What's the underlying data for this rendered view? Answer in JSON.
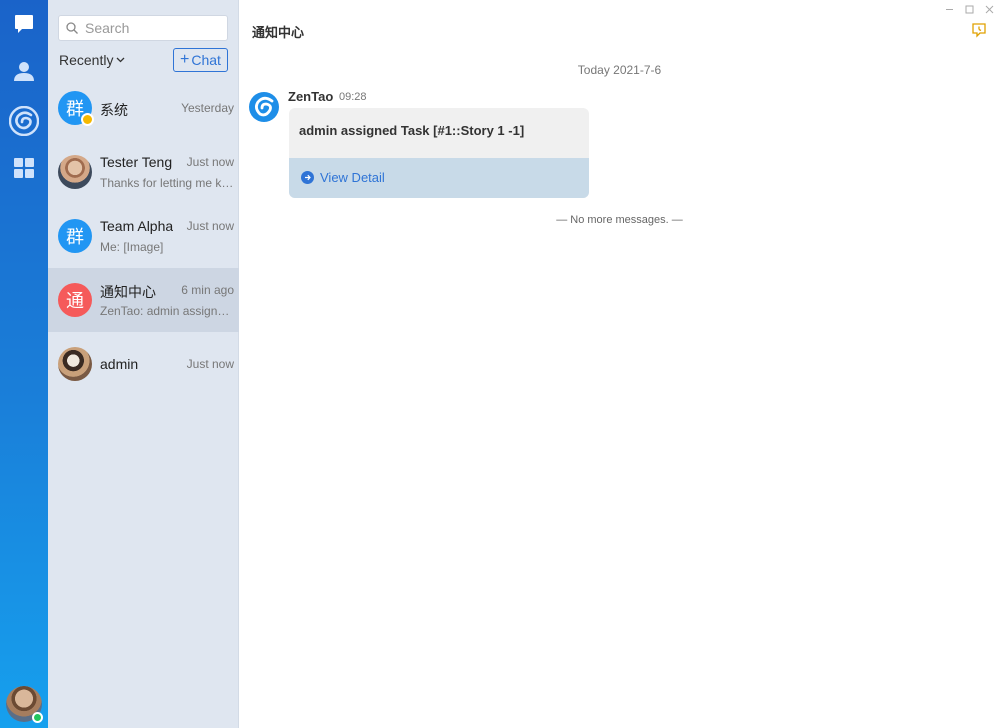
{
  "colors": {
    "rail_top": "#1a63c9",
    "rail_bottom": "#16a0ee",
    "accent": "#2f74d6",
    "online": "#22c55e"
  },
  "rail": {
    "items": [
      "chat-bubble-icon",
      "contacts-icon",
      "zentao-icon",
      "apps-grid-icon"
    ]
  },
  "search": {
    "placeholder": "Search"
  },
  "list_header": {
    "recently": "Recently",
    "chat_button": "Chat"
  },
  "conversations": [
    {
      "avatar_text": "群",
      "name": "系统",
      "time": "Yesterday",
      "preview": ""
    },
    {
      "avatar_text": "",
      "name": "Tester Teng",
      "time": "Just now",
      "preview": "Thanks for letting me know."
    },
    {
      "avatar_text": "群",
      "name": "Team Alpha",
      "time": "Just now",
      "preview": "Me: [Image]"
    },
    {
      "avatar_text": "通",
      "name": "通知中心",
      "time": "6 min ago",
      "preview": "ZenTao: admin assigned Task"
    },
    {
      "avatar_text": "",
      "name": "admin",
      "time": "Just now",
      "preview": ""
    }
  ],
  "main": {
    "title": "通知中心",
    "date_separator": "Today 2021-7-6",
    "message": {
      "sender": "ZenTao",
      "time": "09:28",
      "text": "admin assigned Task [#1::Story 1 -1]",
      "action": "View Detail"
    },
    "end_notice": "— No more messages. —"
  }
}
